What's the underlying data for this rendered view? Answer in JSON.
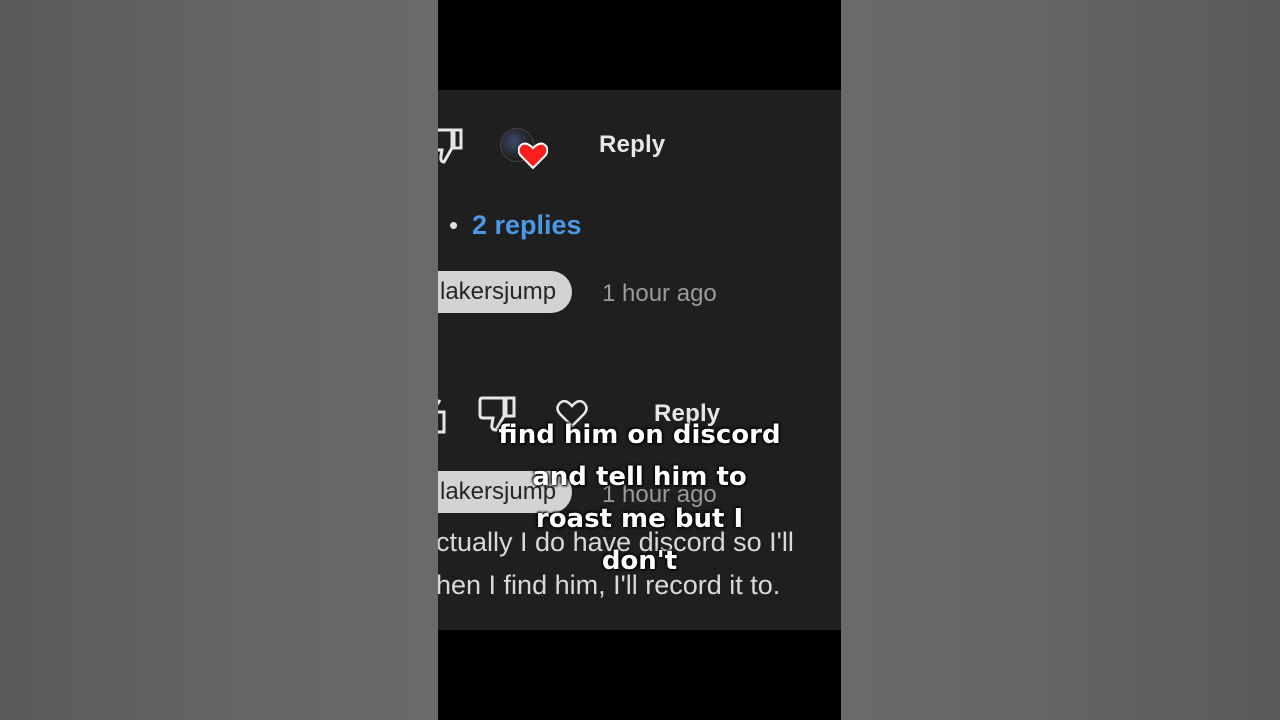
{
  "thread": {
    "top_reply_label": "Reply",
    "replies_dot": "•",
    "replies_link": "2 replies",
    "comment1": {
      "username": "lakersjump",
      "time": "1 hour ago",
      "reply_label": "Reply"
    },
    "comment2": {
      "username": "lakersjump",
      "time": "1 hour ago",
      "lines": [
        "ctually I do have discord so I'll",
        "hen I find him, I'll record it to."
      ]
    }
  },
  "caption": {
    "lines": [
      "find him on discord",
      "and tell him to",
      "roast me but I",
      "don't"
    ]
  },
  "colors": {
    "heart": "#ff1e1e",
    "link": "#4a98e6",
    "background": "#1f1f1f"
  },
  "icons": [
    "thumbs-down-icon",
    "heart-icon",
    "avatar",
    "thumbs-up-icon"
  ]
}
